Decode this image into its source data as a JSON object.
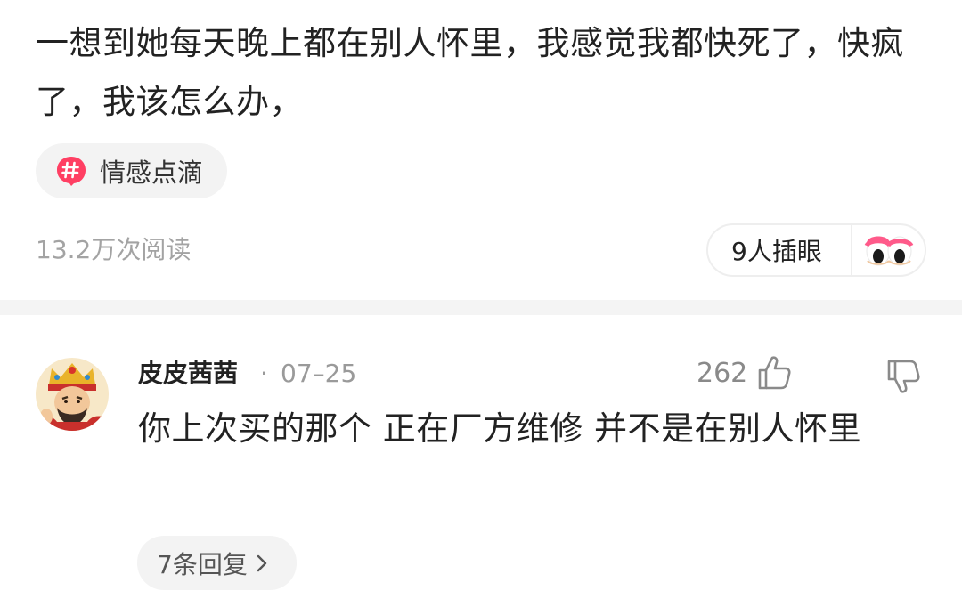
{
  "post": {
    "text": "一想到她每天晚上都在别人怀里，我感觉我都快死了，快疯了，我该怎么办，",
    "topic": {
      "label": "情感点滴",
      "icon": "hashtag-icon",
      "icon_color": "#ff3f63"
    },
    "read_count": "13.2万次阅读",
    "peek": {
      "label": "9人插眼",
      "icon": "peeking-eyes-icon"
    }
  },
  "comment": {
    "username": "皮皮茜茜",
    "separator": "·",
    "date": "07–25",
    "like_count": "262",
    "text": "你上次买的那个 正在厂方维修 并不是在别人怀里",
    "replies_label": "7条回复",
    "icons": {
      "avatar": "avatar-image",
      "like": "thumbs-up-icon",
      "dislike": "thumbs-down-icon",
      "chevron": "chevron-right-icon"
    }
  },
  "colors": {
    "text_primary": "#222222",
    "text_secondary": "#9a9a9a",
    "chip_background": "#f3f3f3",
    "separator": "#f4f4f4",
    "accent": "#ff3f63"
  }
}
